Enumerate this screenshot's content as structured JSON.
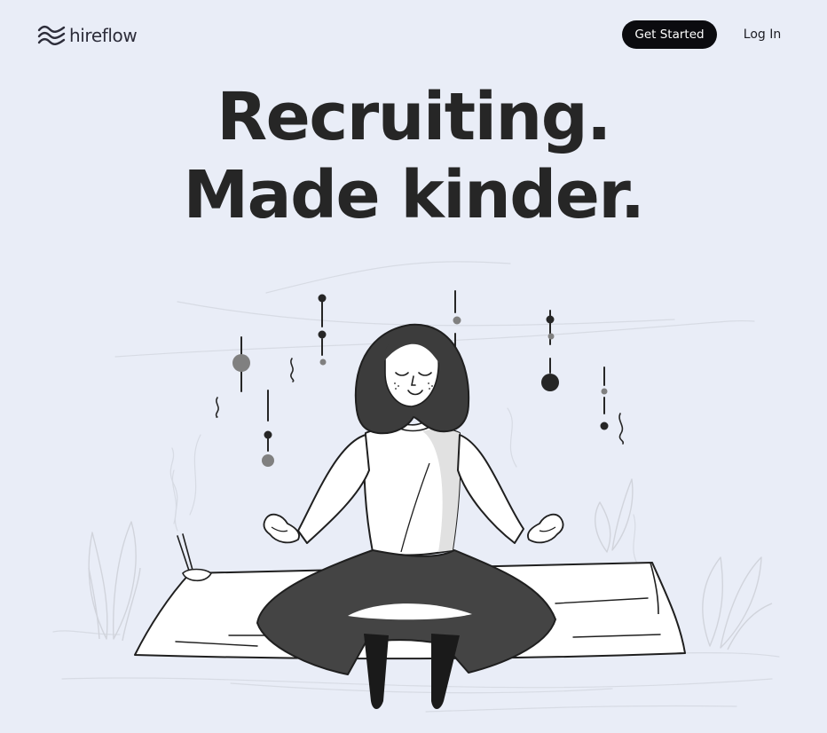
{
  "brand": {
    "name": "hireflow",
    "logo_icon": "waves-icon"
  },
  "nav": {
    "get_started_label": "Get Started",
    "login_label": "Log In"
  },
  "hero": {
    "line1": "Recruiting.",
    "line2": "Made kinder."
  },
  "illustration": {
    "subject": "meditation-illustration-icon"
  },
  "colors": {
    "background": "#e9edf7",
    "primary_button": "#0b0b0f",
    "text": "#262626"
  }
}
